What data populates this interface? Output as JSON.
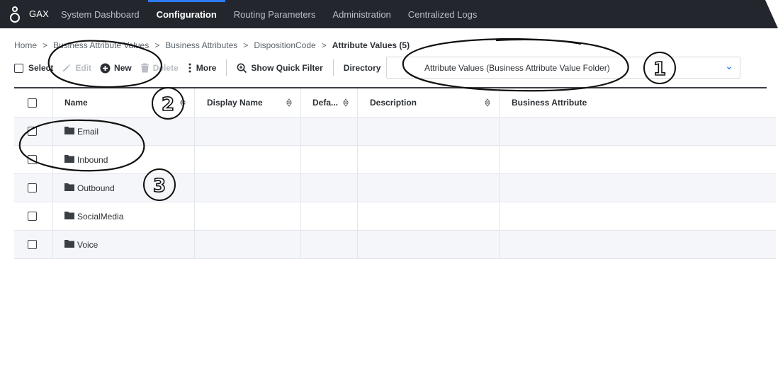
{
  "nav": {
    "brand": "GAX",
    "items": [
      {
        "label": "System Dashboard",
        "active": false
      },
      {
        "label": "Configuration",
        "active": true
      },
      {
        "label": "Routing Parameters",
        "active": false
      },
      {
        "label": "Administration",
        "active": false
      },
      {
        "label": "Centralized Logs",
        "active": false
      }
    ]
  },
  "breadcrumb": {
    "items": [
      "Home",
      "Business Attribute Values",
      "Business Attributes",
      "DispositionCode"
    ],
    "current": "Attribute Values (5)",
    "separator": ">"
  },
  "toolbar": {
    "select_label": "Select",
    "edit_label": "Edit",
    "new_label": "New",
    "delete_label": "Delete",
    "more_label": "More",
    "quick_filter_label": "Show Quick Filter",
    "directory_label": "Directory",
    "directory_value": "Attribute Values (Business Attribute Value Folder)"
  },
  "table": {
    "columns": [
      "Name",
      "Display Name",
      "Defa...",
      "Description",
      "Business Attribute"
    ],
    "rows": [
      {
        "name": "Email"
      },
      {
        "name": "Inbound"
      },
      {
        "name": "Outbound"
      },
      {
        "name": "SocialMedia"
      },
      {
        "name": "Voice"
      }
    ]
  },
  "annotations": [
    "1",
    "2",
    "3"
  ],
  "colors": {
    "topbar": "#23272d",
    "accent": "#2e7bf6",
    "row_alt": "#f4f6f9"
  }
}
